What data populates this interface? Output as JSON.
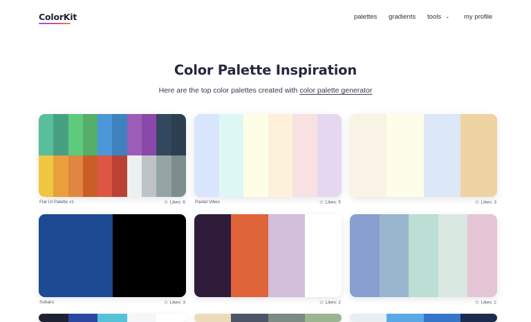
{
  "brand": {
    "name": "ColorKit"
  },
  "nav": {
    "items": [
      {
        "label": "palettes",
        "id": "palettes"
      },
      {
        "label": "gradients",
        "id": "gradients"
      },
      {
        "label": "tools",
        "id": "tools",
        "dropdown": true
      },
      {
        "label": "my profile",
        "id": "my-profile"
      }
    ]
  },
  "hero": {
    "title": "Color Palette Inspiration",
    "subtitle_prefix": "Here are the top color palettes created with ",
    "subtitle_link": "color palette generator"
  },
  "icons": {
    "chevron": "chevron-down-icon",
    "star": "star-outline-icon"
  },
  "palettes": [
    {
      "name": "Flat UI Palette v1",
      "likes": "Likes: 6",
      "rows": [
        [
          "#59be9c",
          "#48a083",
          "#5ecb7c",
          "#55ae6a",
          "#4a98d8",
          "#3f82bd",
          "#9b5db7",
          "#8a48aa",
          "#33475e",
          "#2c3e50"
        ],
        [
          "#f0c741",
          "#ea9e3d",
          "#df8740",
          "#c95f27",
          "#dd5545",
          "#b94234",
          "#ecf0f1",
          "#bdc3c6",
          "#95a5a6",
          "#7f8c8d"
        ]
      ]
    },
    {
      "name": "Pastel Vibes",
      "likes": "Likes: 5",
      "rows": [
        [
          "#dae6fd",
          "#ddf7f5",
          "#fefee6",
          "#fdf1da",
          "#f8e1e2",
          "#e6d7f0"
        ]
      ]
    },
    {
      "name": "",
      "likes": "Likes: 3",
      "rows": [
        [
          "#f8f3e5",
          "#fefde9",
          "#dce7f7",
          "#efd3a2"
        ]
      ]
    },
    {
      "name": "Subaru",
      "likes": "Likes: 3",
      "rows": [
        [
          "#1d4a92",
          "#000000"
        ]
      ]
    },
    {
      "name": "",
      "likes": "Likes: 2",
      "rows": [
        [
          "#2f1c3a",
          "#e0643a",
          "#d2bddb",
          "#ffffff"
        ]
      ]
    },
    {
      "name": "",
      "likes": "Likes: 2",
      "rows": [
        [
          "#889fcf",
          "#9ab6cf",
          "#bcded4",
          "#d9e8e0",
          "#e6c5d7"
        ]
      ]
    },
    {
      "name": "",
      "likes": "",
      "rows": [
        [
          "#1f2233",
          "#2b47a0",
          "#56c2da",
          "#f4f6f8",
          "#ffffff"
        ]
      ]
    },
    {
      "name": "",
      "likes": "",
      "rows": [
        [
          "#ecdbb8",
          "#4c5567",
          "#7a8c84",
          "#9cb48f"
        ]
      ]
    },
    {
      "name": "",
      "likes": "",
      "rows": [
        [
          "#e8eef2",
          "#5aa9e6",
          "#3576c8",
          "#1b2c4e"
        ]
      ]
    }
  ]
}
